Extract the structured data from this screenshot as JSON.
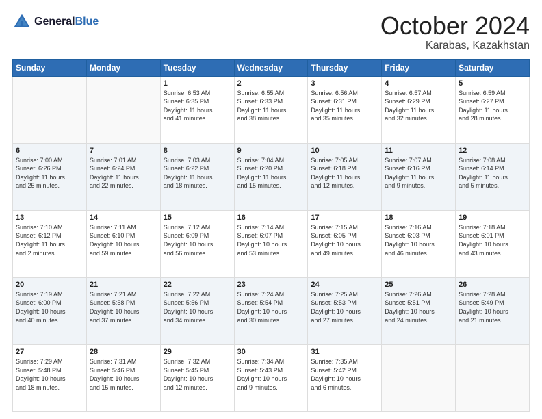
{
  "header": {
    "logo_line1": "General",
    "logo_line2": "Blue",
    "month": "October 2024",
    "location": "Karabas, Kazakhstan"
  },
  "weekdays": [
    "Sunday",
    "Monday",
    "Tuesday",
    "Wednesday",
    "Thursday",
    "Friday",
    "Saturday"
  ],
  "weeks": [
    [
      {
        "day": "",
        "content": ""
      },
      {
        "day": "",
        "content": ""
      },
      {
        "day": "1",
        "content": "Sunrise: 6:53 AM\nSunset: 6:35 PM\nDaylight: 11 hours\nand 41 minutes."
      },
      {
        "day": "2",
        "content": "Sunrise: 6:55 AM\nSunset: 6:33 PM\nDaylight: 11 hours\nand 38 minutes."
      },
      {
        "day": "3",
        "content": "Sunrise: 6:56 AM\nSunset: 6:31 PM\nDaylight: 11 hours\nand 35 minutes."
      },
      {
        "day": "4",
        "content": "Sunrise: 6:57 AM\nSunset: 6:29 PM\nDaylight: 11 hours\nand 32 minutes."
      },
      {
        "day": "5",
        "content": "Sunrise: 6:59 AM\nSunset: 6:27 PM\nDaylight: 11 hours\nand 28 minutes."
      }
    ],
    [
      {
        "day": "6",
        "content": "Sunrise: 7:00 AM\nSunset: 6:26 PM\nDaylight: 11 hours\nand 25 minutes."
      },
      {
        "day": "7",
        "content": "Sunrise: 7:01 AM\nSunset: 6:24 PM\nDaylight: 11 hours\nand 22 minutes."
      },
      {
        "day": "8",
        "content": "Sunrise: 7:03 AM\nSunset: 6:22 PM\nDaylight: 11 hours\nand 18 minutes."
      },
      {
        "day": "9",
        "content": "Sunrise: 7:04 AM\nSunset: 6:20 PM\nDaylight: 11 hours\nand 15 minutes."
      },
      {
        "day": "10",
        "content": "Sunrise: 7:05 AM\nSunset: 6:18 PM\nDaylight: 11 hours\nand 12 minutes."
      },
      {
        "day": "11",
        "content": "Sunrise: 7:07 AM\nSunset: 6:16 PM\nDaylight: 11 hours\nand 9 minutes."
      },
      {
        "day": "12",
        "content": "Sunrise: 7:08 AM\nSunset: 6:14 PM\nDaylight: 11 hours\nand 5 minutes."
      }
    ],
    [
      {
        "day": "13",
        "content": "Sunrise: 7:10 AM\nSunset: 6:12 PM\nDaylight: 11 hours\nand 2 minutes."
      },
      {
        "day": "14",
        "content": "Sunrise: 7:11 AM\nSunset: 6:10 PM\nDaylight: 10 hours\nand 59 minutes."
      },
      {
        "day": "15",
        "content": "Sunrise: 7:12 AM\nSunset: 6:09 PM\nDaylight: 10 hours\nand 56 minutes."
      },
      {
        "day": "16",
        "content": "Sunrise: 7:14 AM\nSunset: 6:07 PM\nDaylight: 10 hours\nand 53 minutes."
      },
      {
        "day": "17",
        "content": "Sunrise: 7:15 AM\nSunset: 6:05 PM\nDaylight: 10 hours\nand 49 minutes."
      },
      {
        "day": "18",
        "content": "Sunrise: 7:16 AM\nSunset: 6:03 PM\nDaylight: 10 hours\nand 46 minutes."
      },
      {
        "day": "19",
        "content": "Sunrise: 7:18 AM\nSunset: 6:01 PM\nDaylight: 10 hours\nand 43 minutes."
      }
    ],
    [
      {
        "day": "20",
        "content": "Sunrise: 7:19 AM\nSunset: 6:00 PM\nDaylight: 10 hours\nand 40 minutes."
      },
      {
        "day": "21",
        "content": "Sunrise: 7:21 AM\nSunset: 5:58 PM\nDaylight: 10 hours\nand 37 minutes."
      },
      {
        "day": "22",
        "content": "Sunrise: 7:22 AM\nSunset: 5:56 PM\nDaylight: 10 hours\nand 34 minutes."
      },
      {
        "day": "23",
        "content": "Sunrise: 7:24 AM\nSunset: 5:54 PM\nDaylight: 10 hours\nand 30 minutes."
      },
      {
        "day": "24",
        "content": "Sunrise: 7:25 AM\nSunset: 5:53 PM\nDaylight: 10 hours\nand 27 minutes."
      },
      {
        "day": "25",
        "content": "Sunrise: 7:26 AM\nSunset: 5:51 PM\nDaylight: 10 hours\nand 24 minutes."
      },
      {
        "day": "26",
        "content": "Sunrise: 7:28 AM\nSunset: 5:49 PM\nDaylight: 10 hours\nand 21 minutes."
      }
    ],
    [
      {
        "day": "27",
        "content": "Sunrise: 7:29 AM\nSunset: 5:48 PM\nDaylight: 10 hours\nand 18 minutes."
      },
      {
        "day": "28",
        "content": "Sunrise: 7:31 AM\nSunset: 5:46 PM\nDaylight: 10 hours\nand 15 minutes."
      },
      {
        "day": "29",
        "content": "Sunrise: 7:32 AM\nSunset: 5:45 PM\nDaylight: 10 hours\nand 12 minutes."
      },
      {
        "day": "30",
        "content": "Sunrise: 7:34 AM\nSunset: 5:43 PM\nDaylight: 10 hours\nand 9 minutes."
      },
      {
        "day": "31",
        "content": "Sunrise: 7:35 AM\nSunset: 5:42 PM\nDaylight: 10 hours\nand 6 minutes."
      },
      {
        "day": "",
        "content": ""
      },
      {
        "day": "",
        "content": ""
      }
    ]
  ]
}
